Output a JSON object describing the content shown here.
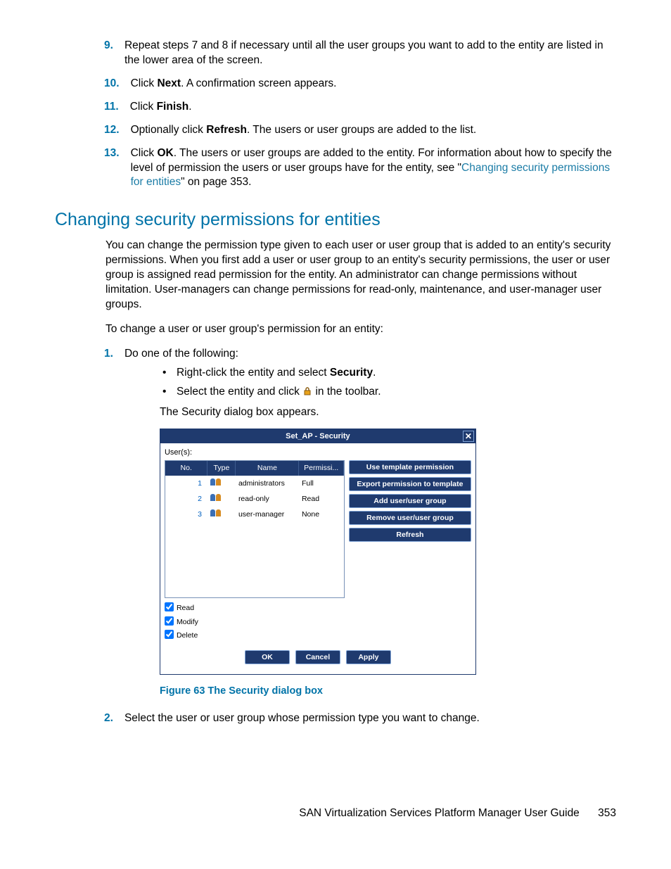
{
  "steps_a": [
    {
      "n": "9.",
      "html": "Repeat steps 7 and 8 if necessary until all the user groups you want to add to the entity are listed in the lower area of the screen."
    },
    {
      "n": "10.",
      "html": "Click <b>Next</b>. A confirmation screen appears."
    },
    {
      "n": "11.",
      "html": "Click <b>Finish</b>."
    },
    {
      "n": "12.",
      "html": "Optionally click <b>Refresh</b>. The users or user groups are added to the list."
    },
    {
      "n": "13.",
      "html": "Click <b>OK</b>. The users or user groups are added to the entity. For information about how to specify the level of permission the users or user groups have for the entity, see \"<a class=\"link\" href=\"#\">Changing security permissions for entities</a>\" on page 353."
    }
  ],
  "heading": "Changing security permissions for entities",
  "para1": "You can change the permission type given to each user or user group that is added to an entity's security permissions. When you first add a user or user group to an entity's security permissions, the user or user group is assigned read permission for the entity. An administrator can change permissions without limitation. User-managers can change permissions for read-only, maintenance, and user-manager user groups.",
  "para2": "To change a user or user group's permission for an entity:",
  "step1": {
    "n": "1.",
    "text": "Do one of the following:"
  },
  "bullets": [
    "Right-click the entity and select <b>Security</b>.",
    "Select the entity and click <span class=\"lock-icon\"><svg viewBox=\"0 0 14 14\"><rect x=\"3\" y=\"6\" width=\"8\" height=\"6\" fill=\"#e8a21c\" stroke=\"#8a5a0c\"/><path d=\"M5 6 V4 a2 2 0 0 1 4 0 V6\" fill=\"none\" stroke=\"#8a5a0c\" stroke-width=\"1.4\"/></svg></span> in the toolbar."
  ],
  "after_bullets": "The Security dialog box appears.",
  "dialog": {
    "title": "Set_AP - Security",
    "users_label": "User(s):",
    "cols": [
      "No.",
      "Type",
      "Name",
      "Permissi..."
    ],
    "rows": [
      {
        "no": "1",
        "name": "administrators",
        "perm": "Full"
      },
      {
        "no": "2",
        "name": "read-only",
        "perm": "Read"
      },
      {
        "no": "3",
        "name": "user-manager",
        "perm": "None"
      }
    ],
    "btns": [
      "Use template permission",
      "Export permission to template",
      "Add user/user group",
      "Remove user/user group",
      "Refresh"
    ],
    "checks": [
      "Read",
      "Modify",
      "Delete"
    ],
    "bottom": [
      "OK",
      "Cancel",
      "Apply"
    ]
  },
  "figcap": "Figure 63 The Security dialog box",
  "step2": {
    "n": "2.",
    "text": "Select the user or user group whose permission type you want to change."
  },
  "footer_doc": "SAN Virtualization Services Platform Manager User Guide",
  "footer_page": "353"
}
